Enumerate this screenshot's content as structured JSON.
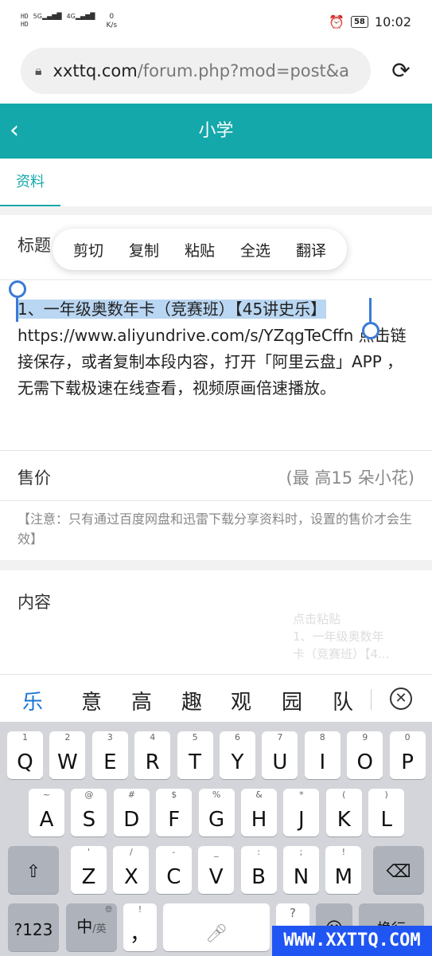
{
  "status_bar": {
    "network_type_top": "HD",
    "network_type_bottom": "HD",
    "signal1": "5G",
    "signal2": "4G",
    "speed_value": "0",
    "speed_unit": "K/s",
    "battery": "58",
    "time": "10:02"
  },
  "browser": {
    "url_domain": "xxttq.com",
    "url_path": "/forum.php?mod=post&a"
  },
  "header": {
    "title": "小学"
  },
  "tabs": [
    {
      "label": "资料"
    }
  ],
  "form": {
    "title_label": "标题",
    "context_menu": [
      "剪切",
      "复制",
      "粘贴",
      "全选",
      "翻译"
    ],
    "body_selected": "1、一年级奥数年卡（竞赛班）【45讲史乐】",
    "body_rest": "https://www.aliyundrive.com/s/YZqgTeCffn 点击链接保存，或者复制本段内容，打开「阿里云盘」APP ，无需下载极速在线查看，视频原画倍速播放。",
    "price_label": "售价",
    "price_placeholder": "(最 高15 朵小花)",
    "note": "【注意：只有通过百度网盘和迅雷下载分享资料时，设置的售价才会生效】",
    "content_label": "内容",
    "clipboard_hint": "点击粘贴\n1、一年级奥数年\n卡（竞赛班）【4..."
  },
  "candidates": [
    "乐",
    "意",
    "高",
    "趣",
    "观",
    "园",
    "队"
  ],
  "keyboard": {
    "row1": [
      {
        "main": "Q",
        "sub": "1"
      },
      {
        "main": "W",
        "sub": "2"
      },
      {
        "main": "E",
        "sub": "3"
      },
      {
        "main": "R",
        "sub": "4"
      },
      {
        "main": "T",
        "sub": "5"
      },
      {
        "main": "Y",
        "sub": "6"
      },
      {
        "main": "U",
        "sub": "7"
      },
      {
        "main": "I",
        "sub": "8"
      },
      {
        "main": "O",
        "sub": "9"
      },
      {
        "main": "P",
        "sub": "0"
      }
    ],
    "row2": [
      {
        "main": "A",
        "sub": "~"
      },
      {
        "main": "S",
        "sub": "@"
      },
      {
        "main": "D",
        "sub": "#"
      },
      {
        "main": "F",
        "sub": "$"
      },
      {
        "main": "G",
        "sub": "%"
      },
      {
        "main": "H",
        "sub": "&"
      },
      {
        "main": "J",
        "sub": "*"
      },
      {
        "main": "K",
        "sub": "("
      },
      {
        "main": "L",
        "sub": ")"
      }
    ],
    "row3": [
      {
        "main": "Z",
        "sub": "'"
      },
      {
        "main": "X",
        "sub": "/"
      },
      {
        "main": "C",
        "sub": "-"
      },
      {
        "main": "V",
        "sub": "_"
      },
      {
        "main": "B",
        "sub": ":"
      },
      {
        "main": "N",
        "sub": ";"
      },
      {
        "main": "M",
        "sub": "!"
      }
    ],
    "num_key": "?123",
    "lang_key_main": "中",
    "lang_key_sub": "/英",
    "comma_key": "，",
    "comma_sub": "!",
    "question_key": "?",
    "enter_key": "换行"
  },
  "watermark": "WWW.XXTTQ.COM"
}
